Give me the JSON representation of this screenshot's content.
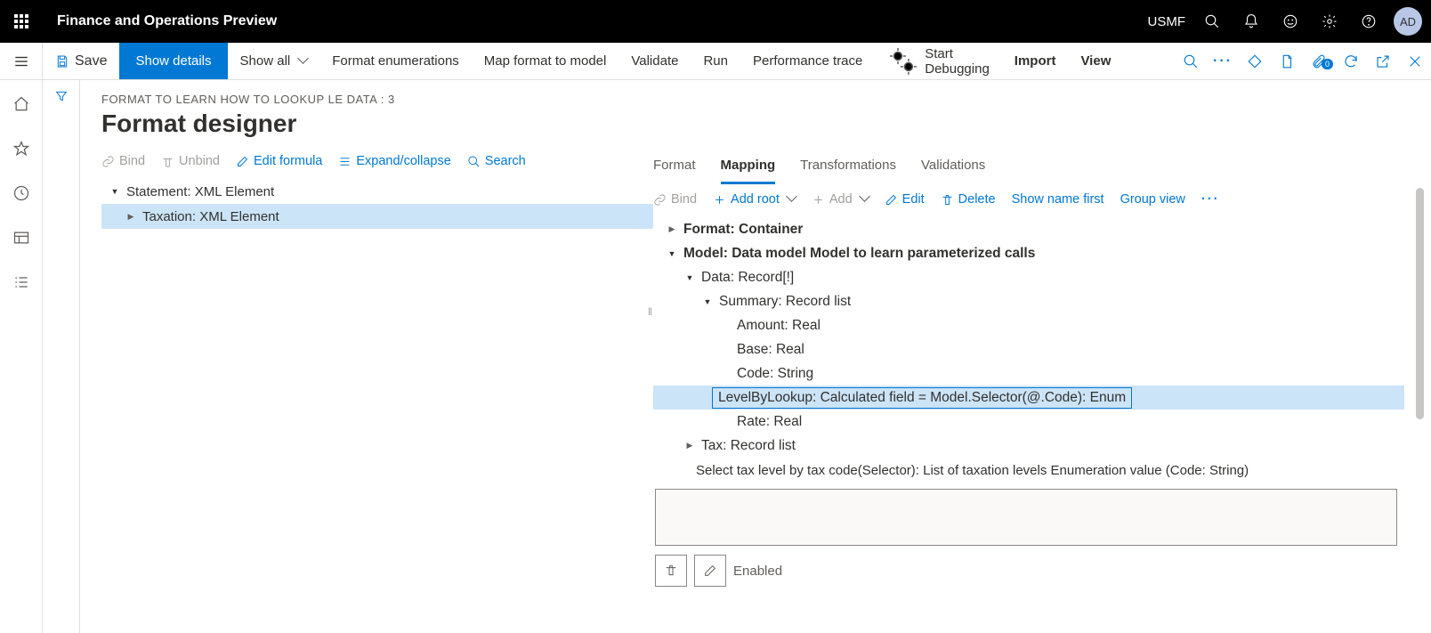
{
  "header": {
    "app_title": "Finance and Operations Preview",
    "company": "USMF",
    "avatar_initials": "AD"
  },
  "commandbar": {
    "save": "Save",
    "show_details": "Show details",
    "show_all": "Show all",
    "format_enum": "Format enumerations",
    "map_format": "Map format to model",
    "validate": "Validate",
    "run": "Run",
    "perf_trace": "Performance trace",
    "start_debug": "Start Debugging",
    "import": "Import",
    "view": "View",
    "badge_count": "0"
  },
  "page": {
    "breadcrumb": "FORMAT TO LEARN HOW TO LOOKUP LE DATA : 3",
    "title": "Format designer"
  },
  "left_actions": {
    "bind": "Bind",
    "unbind": "Unbind",
    "edit_formula": "Edit formula",
    "expand": "Expand/collapse",
    "search": "Search"
  },
  "left_tree": {
    "node1": "Statement: XML Element",
    "node2": "Taxation: XML Element"
  },
  "right_tabs": {
    "format": "Format",
    "mapping": "Mapping",
    "transformations": "Transformations",
    "validations": "Validations"
  },
  "right_actions": {
    "bind": "Bind",
    "add_root": "Add root",
    "add": "Add",
    "edit": "Edit",
    "delete": "Delete",
    "show_name_first": "Show name first",
    "group_view": "Group view"
  },
  "right_tree": {
    "n1": "Format: Container",
    "n2": "Model: Data model Model to learn parameterized calls",
    "n3": "Data: Record[!]",
    "n4": "Summary: Record list",
    "n5": "Amount: Real",
    "n6": "Base: Real",
    "n7": "Code: String",
    "n8": "LevelByLookup: Calculated field = Model.Selector(@.Code): Enum",
    "n9": "Rate: Real",
    "n10": "Tax: Record list",
    "desc": "Select tax level by tax code(Selector): List of taxation levels Enumeration value (Code: String)"
  },
  "form": {
    "enabled_label": "Enabled"
  }
}
